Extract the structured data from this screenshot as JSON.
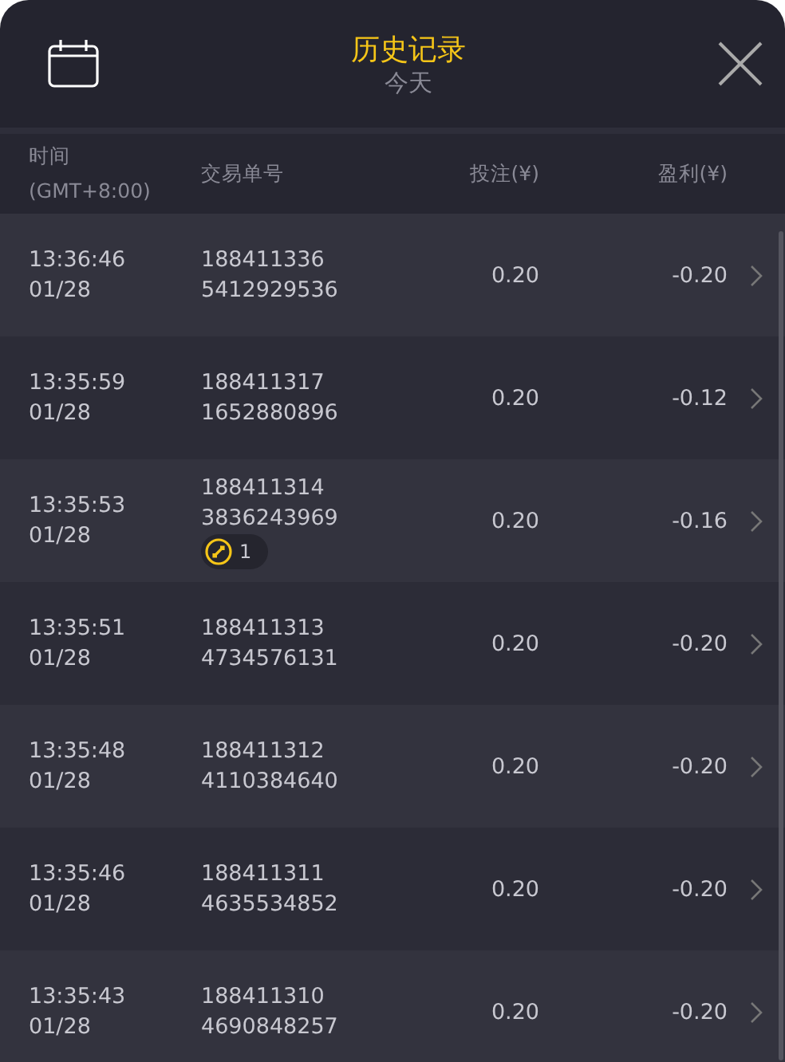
{
  "header": {
    "title": "历史记录",
    "subtitle": "今天"
  },
  "columns": [
    {
      "label": "时间",
      "sublabel": "(GMT+8:00)"
    },
    {
      "label": "交易单号"
    },
    {
      "label": "投注(¥)"
    },
    {
      "label": "盈利(¥)"
    }
  ],
  "rows": [
    {
      "time": "13:36:46",
      "date": "01/28",
      "order_id": "188411336",
      "order_suffix": "5412929536",
      "bet": "0.20",
      "profit": "-0.20"
    },
    {
      "time": "13:35:59",
      "date": "01/28",
      "order_id": "188411317",
      "order_suffix": "1652880896",
      "bet": "0.20",
      "profit": "-0.12"
    },
    {
      "time": "13:35:53",
      "date": "01/28",
      "order_id": "188411314",
      "order_suffix": "3836243969",
      "badge": "1",
      "bet": "0.20",
      "profit": "-0.16"
    },
    {
      "time": "13:35:51",
      "date": "01/28",
      "order_id": "188411313",
      "order_suffix": "4734576131",
      "bet": "0.20",
      "profit": "-0.20"
    },
    {
      "time": "13:35:48",
      "date": "01/28",
      "order_id": "188411312",
      "order_suffix": "4110384640",
      "bet": "0.20",
      "profit": "-0.20"
    },
    {
      "time": "13:35:46",
      "date": "01/28",
      "order_id": "188411311",
      "order_suffix": "4635534852",
      "bet": "0.20",
      "profit": "-0.20"
    },
    {
      "time": "13:35:43",
      "date": "01/28",
      "order_id": "188411310",
      "order_suffix": "4690848257",
      "bet": "0.20",
      "profit": "-0.20"
    }
  ]
}
